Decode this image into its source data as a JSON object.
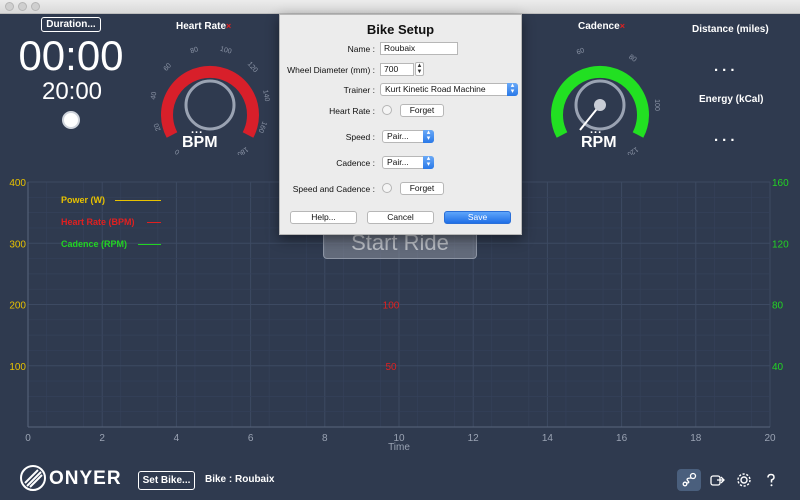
{
  "timer": {
    "duration_button": "Duration...",
    "elapsed": "00:00",
    "target": "20:00"
  },
  "heart_rate_gauge": {
    "title": "Heart Rate",
    "close_mark": "×",
    "unit": "BPM",
    "dots": "...",
    "ticks": [
      "0",
      "20",
      "40",
      "60",
      "80",
      "100",
      "120",
      "140",
      "160",
      "180"
    ]
  },
  "cadence_gauge": {
    "title": "Cadence",
    "close_mark": "×",
    "unit": "RPM",
    "dots": "...",
    "ticks": [
      "60",
      "80",
      "100",
      "120"
    ]
  },
  "distance": {
    "label": "Distance (miles)",
    "value": "..."
  },
  "energy": {
    "label": "Energy (kCal)",
    "value": "..."
  },
  "start_ride": "Start Ride",
  "chart_data": {
    "type": "line",
    "xlabel": "Time",
    "x_ticks": [
      "0",
      "2",
      "4",
      "6",
      "8",
      "10",
      "12",
      "14",
      "16",
      "18",
      "20"
    ],
    "xlim": [
      0,
      20
    ],
    "left_axis": {
      "ticks": [
        "100",
        "200",
        "300",
        "400"
      ],
      "ylim": [
        0,
        400
      ],
      "color": "#e8c200"
    },
    "center_axis": {
      "ticks": [
        "50",
        "100"
      ],
      "color": "#e02020"
    },
    "right_axis": {
      "ticks": [
        "40",
        "80",
        "120",
        "160"
      ],
      "ylim": [
        0,
        160
      ],
      "color": "#22d422"
    },
    "grid": true,
    "series": [
      {
        "name": "Power (W)",
        "color": "#e8c200",
        "values": []
      },
      {
        "name": "Heart Rate (BPM)",
        "color": "#e02020",
        "values": []
      },
      {
        "name": "Cadence (RPM)",
        "color": "#22d422",
        "values": []
      }
    ]
  },
  "bottom": {
    "logo_text": "ONYER",
    "set_bike_button": "Set Bike...",
    "bike_label": "Bike : Roubaix"
  },
  "dialog": {
    "title": "Bike Setup",
    "name_label": "Name :",
    "name_value": "Roubaix",
    "wheel_label": "Wheel Diameter (mm) :",
    "wheel_value": "700",
    "trainer_label": "Trainer :",
    "trainer_value": "Kurt Kinetic Road Machine",
    "heart_rate_label": "Heart Rate :",
    "heart_rate_button": "Forget",
    "speed_label": "Speed :",
    "speed_value": "Pair...",
    "cadence_label": "Cadence :",
    "cadence_value": "Pair...",
    "speed_cadence_label": "Speed and Cadence :",
    "speed_cadence_button": "Forget",
    "help_button": "Help...",
    "cancel_button": "Cancel",
    "save_button": "Save"
  }
}
